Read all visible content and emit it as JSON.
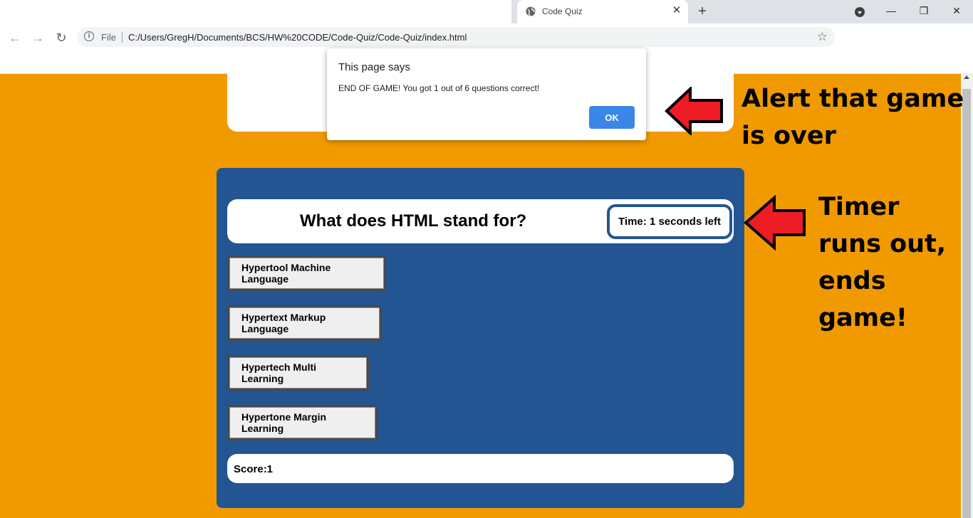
{
  "browser": {
    "tab_title": "Code Quiz",
    "tab_close": "✕",
    "new_tab": "+",
    "window_controls": {
      "minimize": "—",
      "restore": "❐",
      "close": "✕"
    },
    "nav": {
      "back": "←",
      "forward": "→",
      "reload": "↻"
    },
    "address": {
      "scheme": "File",
      "url": "C:/Users/GregH/Documents/BCS/HW%20CODE/Code-Quiz/Code-Quiz/index.html",
      "info_icon": "i",
      "star_icon": "☆"
    }
  },
  "quiz": {
    "question": "What does HTML stand for?",
    "timer": "Time: 1 seconds left",
    "answers": [
      "Hypertool Machine Language",
      "Hypertext Markup Language",
      "Hypertech Multi Learning",
      "Hypertone Margin Learning"
    ],
    "score": "Score:1"
  },
  "dialog": {
    "heading": "This page says",
    "message": "END OF GAME! You got 1 out of 6 questions correct!",
    "ok_label": "OK"
  },
  "annotations": {
    "alert_note": [
      "Alert that game",
      "is over"
    ],
    "timer_note": [
      "Timer",
      "runs out,",
      "ends",
      "game!"
    ]
  },
  "colors": {
    "page_background": "#f09a00",
    "panel_blue": "#225592",
    "ok_button": "#3a86e8",
    "arrow_red": "#ee1c25"
  }
}
